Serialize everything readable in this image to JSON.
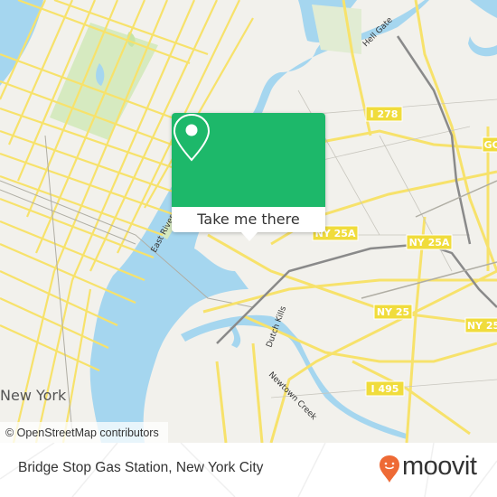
{
  "map": {
    "attribution": "© OpenStreetMap contributors",
    "place_labels": {
      "new_york": "New York",
      "east_river": "East River",
      "hell_gate": "Hell Gate",
      "dutch_kills": "Dutch Kills",
      "newtown_creek": "Newtown Creek"
    },
    "shields": [
      {
        "text": "I 278"
      },
      {
        "text": "GC"
      },
      {
        "text": "NY 25"
      },
      {
        "text": "NY 25A"
      },
      {
        "text": "NY 25A"
      },
      {
        "text": "NY 25"
      },
      {
        "text": "NY 25"
      },
      {
        "text": "I 495"
      }
    ],
    "colors": {
      "water": "#a5d6ef",
      "park": "#d6eac0",
      "road": "#f7e26b",
      "road_edge": "#e0c84a",
      "rail": "#8a8a8a",
      "land": "#f2f1ec",
      "shield": "#f0dc3c"
    }
  },
  "popup": {
    "icon": "location-pin-icon",
    "button_label": "Take me there",
    "color": "#1db86a"
  },
  "footer": {
    "place_name": "Bridge Stop Gas Station, New York City",
    "brand": "moovit",
    "brand_icon": "moovit-pin-logo-icon",
    "brand_color": "#ee6a35"
  }
}
